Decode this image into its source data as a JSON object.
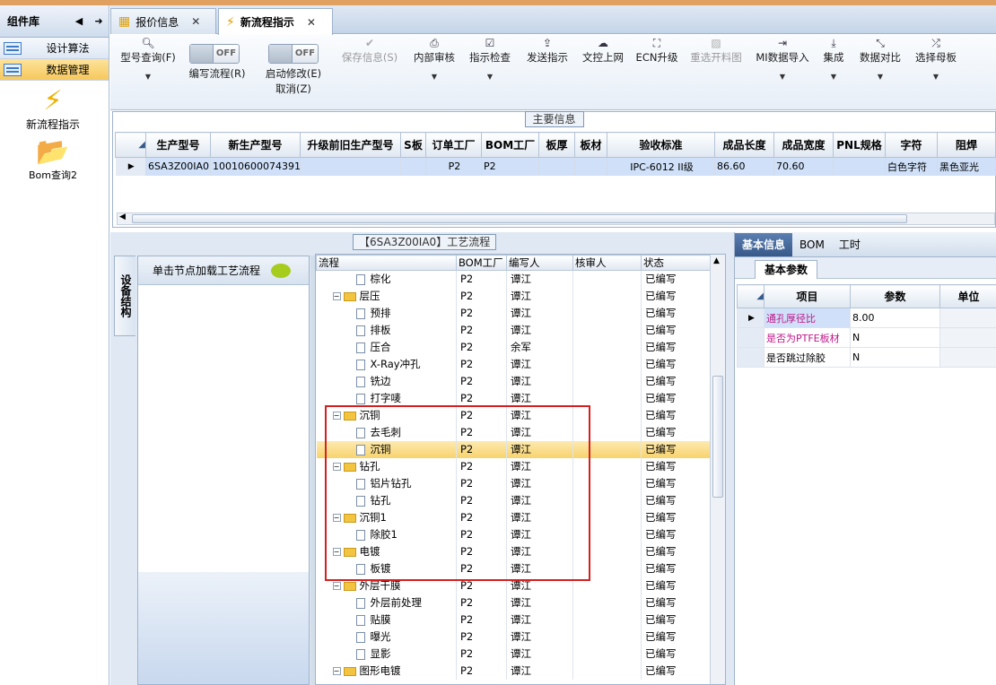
{
  "sidebar": {
    "title": "组件库",
    "items": [
      {
        "label": "设计算法",
        "selected": false
      },
      {
        "label": "数据管理",
        "selected": true
      }
    ],
    "apps": [
      {
        "label": "新流程指示",
        "icon": "lightning-icon"
      },
      {
        "label": "Bom查询2",
        "icon": "folder-icon"
      }
    ]
  },
  "tabs": [
    {
      "label": "报价信息",
      "active": false
    },
    {
      "label": "新流程指示",
      "active": true
    }
  ],
  "toolbar": {
    "query": "型号查询(F)",
    "edit_flow": "编写流程(R)",
    "start_modify": "启动修改(E)",
    "cancel": "取消(Z)",
    "toggle_off": "OFF",
    "save": "保存信息(S)",
    "internal_review": "内部审核",
    "instruction_check": "指示检查",
    "send_instruction": "发送指示",
    "upload": "文控上网",
    "ecn": "ECN升级",
    "reselect": "重选开料图",
    "mi_import": "MI数据导入",
    "integrate": "集成",
    "compare": "数据对比",
    "select_master": "选择母板"
  },
  "main_info": {
    "title": "主要信息",
    "columns": [
      "生产型号",
      "新生产型号",
      "升级前旧生产型号",
      "S板",
      "订单工厂",
      "BOM工厂",
      "板厚",
      "板材",
      "验收标准",
      "成品长度",
      "成品宽度",
      "PNL规格",
      "字符",
      "阻焊"
    ],
    "row": [
      "6SA3Z00IA0",
      "10010600074391",
      "",
      "",
      "P2",
      "P2",
      "",
      "",
      "IPC-6012 II级",
      "86.60",
      "70.60",
      "",
      "白色字符",
      "黑色亚光"
    ]
  },
  "process": {
    "title": "【6SA3Z00IA0】工艺流程",
    "side_tab": "设备结构",
    "node_hint": "单击节点加载工艺流程",
    "columns": [
      "流程",
      "BOM工厂",
      "编写人",
      "核审人",
      "状态"
    ],
    "rows": [
      {
        "name": "棕化",
        "type": "doc",
        "level": 1,
        "factory": "P2",
        "writer": "谭江",
        "reviewer": "",
        "status": "已编写"
      },
      {
        "name": "层压",
        "type": "folder",
        "level": 0,
        "factory": "P2",
        "writer": "谭江",
        "reviewer": "",
        "status": "已编写"
      },
      {
        "name": "预排",
        "type": "doc",
        "level": 1,
        "factory": "P2",
        "writer": "谭江",
        "reviewer": "",
        "status": "已编写"
      },
      {
        "name": "排板",
        "type": "doc",
        "level": 1,
        "factory": "P2",
        "writer": "谭江",
        "reviewer": "",
        "status": "已编写"
      },
      {
        "name": "压合",
        "type": "doc",
        "level": 1,
        "factory": "P2",
        "writer": "余军",
        "reviewer": "",
        "status": "已编写"
      },
      {
        "name": "X-Ray冲孔",
        "type": "doc",
        "level": 1,
        "factory": "P2",
        "writer": "谭江",
        "reviewer": "",
        "status": "已编写"
      },
      {
        "name": "铣边",
        "type": "doc",
        "level": 1,
        "factory": "P2",
        "writer": "谭江",
        "reviewer": "",
        "status": "已编写"
      },
      {
        "name": "打字唛",
        "type": "doc",
        "level": 1,
        "factory": "P2",
        "writer": "谭江",
        "reviewer": "",
        "status": "已编写"
      },
      {
        "name": "沉铜",
        "type": "folder",
        "level": 0,
        "factory": "P2",
        "writer": "谭江",
        "reviewer": "",
        "status": "已编写"
      },
      {
        "name": "去毛刺",
        "type": "doc",
        "level": 1,
        "factory": "P2",
        "writer": "谭江",
        "reviewer": "",
        "status": "已编写"
      },
      {
        "name": "沉铜",
        "type": "doc",
        "level": 1,
        "factory": "P2",
        "writer": "谭江",
        "reviewer": "",
        "status": "已编写",
        "highlight": true
      },
      {
        "name": "钻孔",
        "type": "folder",
        "level": 0,
        "factory": "P2",
        "writer": "谭江",
        "reviewer": "",
        "status": "已编写"
      },
      {
        "name": "铝片钻孔",
        "type": "doc",
        "level": 1,
        "factory": "P2",
        "writer": "谭江",
        "reviewer": "",
        "status": "已编写"
      },
      {
        "name": "钻孔",
        "type": "doc",
        "level": 1,
        "factory": "P2",
        "writer": "谭江",
        "reviewer": "",
        "status": "已编写"
      },
      {
        "name": "沉铜1",
        "type": "folder",
        "level": 0,
        "factory": "P2",
        "writer": "谭江",
        "reviewer": "",
        "status": "已编写"
      },
      {
        "name": "除胶1",
        "type": "doc",
        "level": 1,
        "factory": "P2",
        "writer": "谭江",
        "reviewer": "",
        "status": "已编写"
      },
      {
        "name": "电镀",
        "type": "folder",
        "level": 0,
        "factory": "P2",
        "writer": "谭江",
        "reviewer": "",
        "status": "已编写"
      },
      {
        "name": "板镀",
        "type": "doc",
        "level": 1,
        "factory": "P2",
        "writer": "谭江",
        "reviewer": "",
        "status": "已编写"
      },
      {
        "name": "外层干膜",
        "type": "folder",
        "level": 0,
        "factory": "P2",
        "writer": "谭江",
        "reviewer": "",
        "status": "已编写"
      },
      {
        "name": "外层前处理",
        "type": "doc",
        "level": 1,
        "factory": "P2",
        "writer": "谭江",
        "reviewer": "",
        "status": "已编写"
      },
      {
        "name": "贴膜",
        "type": "doc",
        "level": 1,
        "factory": "P2",
        "writer": "谭江",
        "reviewer": "",
        "status": "已编写"
      },
      {
        "name": "曝光",
        "type": "doc",
        "level": 1,
        "factory": "P2",
        "writer": "谭江",
        "reviewer": "",
        "status": "已编写"
      },
      {
        "name": "显影",
        "type": "doc",
        "level": 1,
        "factory": "P2",
        "writer": "谭江",
        "reviewer": "",
        "status": "已编写"
      },
      {
        "name": "图形电镀",
        "type": "folder",
        "level": 0,
        "factory": "P2",
        "writer": "谭江",
        "reviewer": "",
        "status": "已编写"
      }
    ]
  },
  "detail": {
    "tabs": [
      "基本信息",
      "BOM",
      "工时"
    ],
    "subtab": "基本参数",
    "columns": [
      "项目",
      "参数",
      "单位"
    ],
    "rows": [
      {
        "item": "通孔厚径比",
        "value": "8.00",
        "unit": "",
        "pink": true,
        "selected": true
      },
      {
        "item": "是否为PTFE板材",
        "value": "N",
        "unit": "",
        "pink": true,
        "selected": false
      },
      {
        "item": "是否跳过除胶",
        "value": "N",
        "unit": "",
        "pink": false,
        "selected": false
      }
    ]
  },
  "colors": {
    "highlight_row": "#f8d36e",
    "annotation_box": "#d42020",
    "pink_text": "#c0168a"
  }
}
